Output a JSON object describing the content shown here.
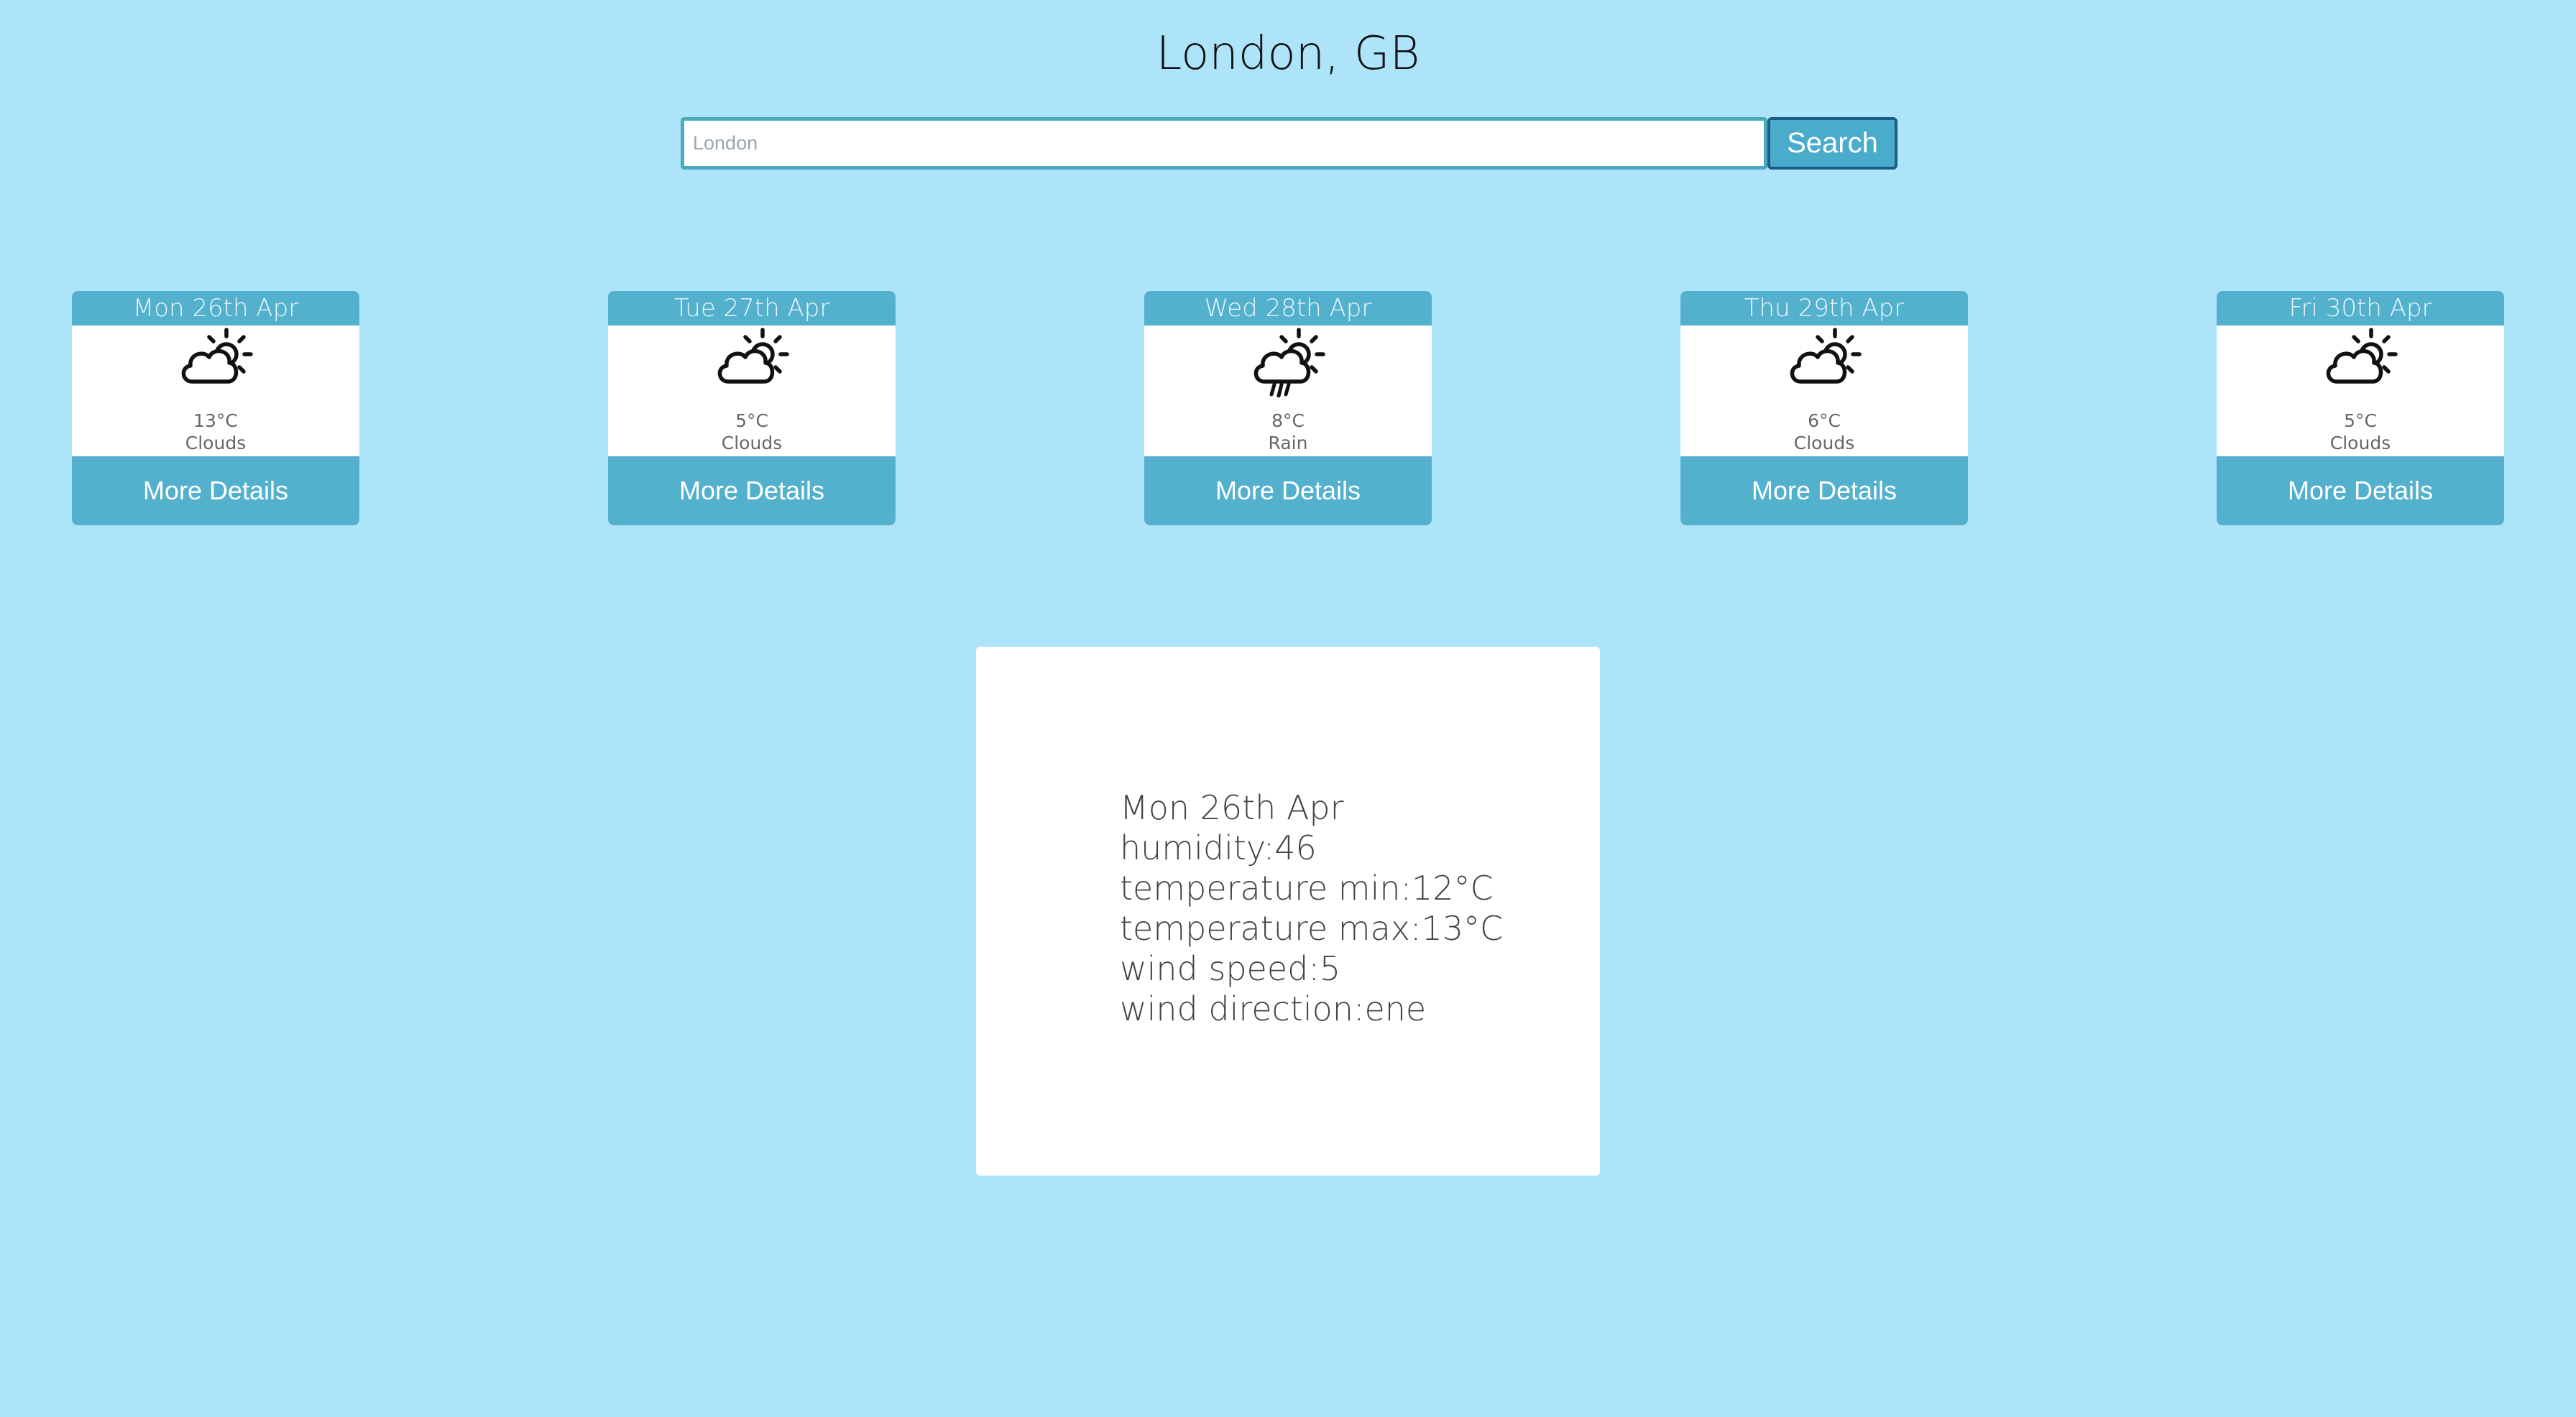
{
  "page": {
    "title": "London, GB"
  },
  "search": {
    "placeholder": "London",
    "value": "",
    "button_label": "Search"
  },
  "forecast": [
    {
      "date": "Mon 26th Apr",
      "temp": "13°C",
      "description": "Clouds",
      "icon": "partly-cloudy-icon",
      "button_label": "More Details"
    },
    {
      "date": "Tue 27th Apr",
      "temp": "5°C",
      "description": "Clouds",
      "icon": "partly-cloudy-icon",
      "button_label": "More Details"
    },
    {
      "date": "Wed 28th Apr",
      "temp": "8°C",
      "description": "Rain",
      "icon": "rain-sun-icon",
      "button_label": "More Details"
    },
    {
      "date": "Thu 29th Apr",
      "temp": "6°C",
      "description": "Clouds",
      "icon": "partly-cloudy-icon",
      "button_label": "More Details"
    },
    {
      "date": "Fri 30th Apr",
      "temp": "5°C",
      "description": "Clouds",
      "icon": "partly-cloudy-icon",
      "button_label": "More Details"
    }
  ],
  "details": {
    "date": "Mon 26th Apr",
    "humidity": "humidity:46",
    "temp_min": "temperature min:12°C",
    "temp_max": "temperature max:13°C",
    "wind_speed": "wind speed:5",
    "wind_direction": "wind direction:ene"
  },
  "colors": {
    "background": "#ade4fa",
    "accent": "#54b1cd",
    "search_border": "#49aabf",
    "search_button": "#4aaccb",
    "search_button_border": "#1b5d84"
  }
}
